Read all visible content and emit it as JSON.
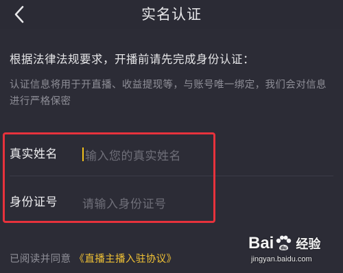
{
  "header": {
    "title": "实名认证",
    "back_icon": "chevron-left-icon"
  },
  "intro": {
    "headline": "根据法律法规要求，开播前请先完成身份认证：",
    "description": "认证信息将用于开直播、收益提现等，与账号唯一绑定，我们会对信息进行严格保密"
  },
  "form": {
    "name_label": "真实姓名",
    "name_placeholder": "输入您的真实姓名",
    "name_value": "",
    "id_label": "身份证号",
    "id_placeholder": "请输入身份证号",
    "id_value": ""
  },
  "agreement": {
    "prefix": "已阅读并同意",
    "link_text": "《直播主播入驻协议》"
  },
  "watermark": {
    "brand_left": "Bai",
    "brand_right": "经验",
    "url": "jingyan.baidu.com"
  },
  "colors": {
    "background": "#2c2c36",
    "accent_link": "#f1c235",
    "caret": "#f4c21b",
    "highlight_border": "#e8323c"
  }
}
